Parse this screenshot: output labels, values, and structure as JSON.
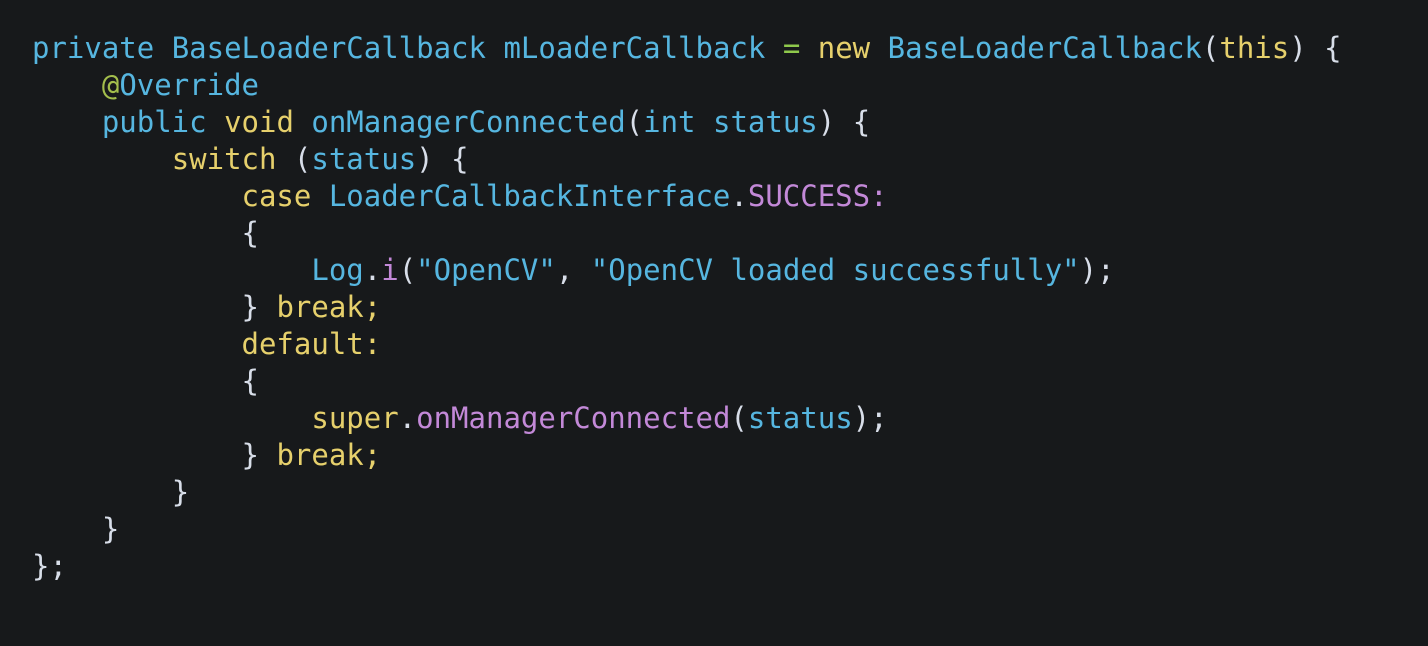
{
  "editor": {
    "language": "Java",
    "background_color": "#17191b",
    "font_size_px": 29,
    "line_height_px": 37,
    "theme_colors": {
      "identifier": "#56b6e0",
      "string": "#56b6e0",
      "keyword": "#e6d06c",
      "annotation_sigil": "#a3be4c",
      "operator": "#8fc94c",
      "method": "#c389d8",
      "punctuation": "#d8dee9"
    },
    "plain_text": "private BaseLoaderCallback mLoaderCallback = new BaseLoaderCallback(this) {\n    @Override\n    public void onManagerConnected(int status) {\n        switch (status) {\n            case LoaderCallbackInterface.SUCCESS:\n            {\n                Log.i(\"OpenCV\", \"OpenCV loaded successfully\");\n            } break;\n            default:\n            {\n                super.onManagerConnected(status);\n            } break;\n        }\n    }\n};",
    "lines": [
      {
        "number": 1,
        "tokens": [
          {
            "text": "private",
            "kind": "ident"
          },
          {
            "text": " ",
            "kind": "plain"
          },
          {
            "text": "BaseLoaderCallback",
            "kind": "ident"
          },
          {
            "text": " ",
            "kind": "plain"
          },
          {
            "text": "mLoaderCallback",
            "kind": "ident"
          },
          {
            "text": " ",
            "kind": "plain"
          },
          {
            "text": "=",
            "kind": "op"
          },
          {
            "text": " ",
            "kind": "plain"
          },
          {
            "text": "new",
            "kind": "kw"
          },
          {
            "text": " ",
            "kind": "plain"
          },
          {
            "text": "BaseLoaderCallback",
            "kind": "ident"
          },
          {
            "text": "(",
            "kind": "punct"
          },
          {
            "text": "this",
            "kind": "kw"
          },
          {
            "text": ")",
            "kind": "punct"
          },
          {
            "text": " ",
            "kind": "plain"
          },
          {
            "text": "{",
            "kind": "punct"
          }
        ]
      },
      {
        "number": 2,
        "tokens": [
          {
            "text": "    ",
            "kind": "plain"
          },
          {
            "text": "@",
            "kind": "anno"
          },
          {
            "text": "Override",
            "kind": "ident"
          }
        ]
      },
      {
        "number": 3,
        "tokens": [
          {
            "text": "    ",
            "kind": "plain"
          },
          {
            "text": "public",
            "kind": "ident"
          },
          {
            "text": " ",
            "kind": "plain"
          },
          {
            "text": "void",
            "kind": "kw"
          },
          {
            "text": " ",
            "kind": "plain"
          },
          {
            "text": "onManagerConnected",
            "kind": "ident"
          },
          {
            "text": "(",
            "kind": "punct"
          },
          {
            "text": "int",
            "kind": "ident"
          },
          {
            "text": " ",
            "kind": "plain"
          },
          {
            "text": "status",
            "kind": "ident"
          },
          {
            "text": ")",
            "kind": "punct"
          },
          {
            "text": " ",
            "kind": "plain"
          },
          {
            "text": "{",
            "kind": "punct"
          }
        ]
      },
      {
        "number": 4,
        "tokens": [
          {
            "text": "        ",
            "kind": "plain"
          },
          {
            "text": "switch",
            "kind": "kw"
          },
          {
            "text": " ",
            "kind": "plain"
          },
          {
            "text": "(",
            "kind": "punct"
          },
          {
            "text": "status",
            "kind": "ident"
          },
          {
            "text": ")",
            "kind": "punct"
          },
          {
            "text": " ",
            "kind": "plain"
          },
          {
            "text": "{",
            "kind": "punct"
          }
        ]
      },
      {
        "number": 5,
        "tokens": [
          {
            "text": "            ",
            "kind": "plain"
          },
          {
            "text": "case",
            "kind": "kw"
          },
          {
            "text": " ",
            "kind": "plain"
          },
          {
            "text": "LoaderCallbackInterface",
            "kind": "ident"
          },
          {
            "text": ".",
            "kind": "punct"
          },
          {
            "text": "SUCCESS",
            "kind": "method"
          },
          {
            "text": ":",
            "kind": "method"
          }
        ]
      },
      {
        "number": 6,
        "tokens": [
          {
            "text": "            ",
            "kind": "plain"
          },
          {
            "text": "{",
            "kind": "punct"
          }
        ]
      },
      {
        "number": 7,
        "tokens": [
          {
            "text": "                ",
            "kind": "plain"
          },
          {
            "text": "Log",
            "kind": "ident"
          },
          {
            "text": ".",
            "kind": "punct"
          },
          {
            "text": "i",
            "kind": "method"
          },
          {
            "text": "(",
            "kind": "punct"
          },
          {
            "text": "\"OpenCV\"",
            "kind": "string"
          },
          {
            "text": ",",
            "kind": "punct"
          },
          {
            "text": " ",
            "kind": "plain"
          },
          {
            "text": "\"OpenCV loaded successfully\"",
            "kind": "string"
          },
          {
            "text": ")",
            "kind": "punct"
          },
          {
            "text": ";",
            "kind": "punct"
          }
        ]
      },
      {
        "number": 8,
        "tokens": [
          {
            "text": "            ",
            "kind": "plain"
          },
          {
            "text": "}",
            "kind": "punct"
          },
          {
            "text": " ",
            "kind": "plain"
          },
          {
            "text": "break",
            "kind": "kw"
          },
          {
            "text": ";",
            "kind": "kw"
          }
        ]
      },
      {
        "number": 9,
        "tokens": [
          {
            "text": "            ",
            "kind": "plain"
          },
          {
            "text": "default",
            "kind": "kw"
          },
          {
            "text": ":",
            "kind": "kw"
          }
        ]
      },
      {
        "number": 10,
        "tokens": [
          {
            "text": "            ",
            "kind": "plain"
          },
          {
            "text": "{",
            "kind": "punct"
          }
        ]
      },
      {
        "number": 11,
        "tokens": [
          {
            "text": "                ",
            "kind": "plain"
          },
          {
            "text": "super",
            "kind": "kw"
          },
          {
            "text": ".",
            "kind": "punct"
          },
          {
            "text": "onManagerConnected",
            "kind": "method"
          },
          {
            "text": "(",
            "kind": "punct"
          },
          {
            "text": "status",
            "kind": "ident"
          },
          {
            "text": ")",
            "kind": "punct"
          },
          {
            "text": ";",
            "kind": "punct"
          }
        ]
      },
      {
        "number": 12,
        "tokens": [
          {
            "text": "            ",
            "kind": "plain"
          },
          {
            "text": "}",
            "kind": "punct"
          },
          {
            "text": " ",
            "kind": "plain"
          },
          {
            "text": "break",
            "kind": "kw"
          },
          {
            "text": ";",
            "kind": "kw"
          }
        ]
      },
      {
        "number": 13,
        "tokens": [
          {
            "text": "        ",
            "kind": "plain"
          },
          {
            "text": "}",
            "kind": "punct"
          }
        ]
      },
      {
        "number": 14,
        "tokens": [
          {
            "text": "    ",
            "kind": "plain"
          },
          {
            "text": "}",
            "kind": "punct"
          }
        ]
      },
      {
        "number": 15,
        "tokens": [
          {
            "text": "}",
            "kind": "punct"
          },
          {
            "text": ";",
            "kind": "punct"
          }
        ]
      }
    ]
  }
}
